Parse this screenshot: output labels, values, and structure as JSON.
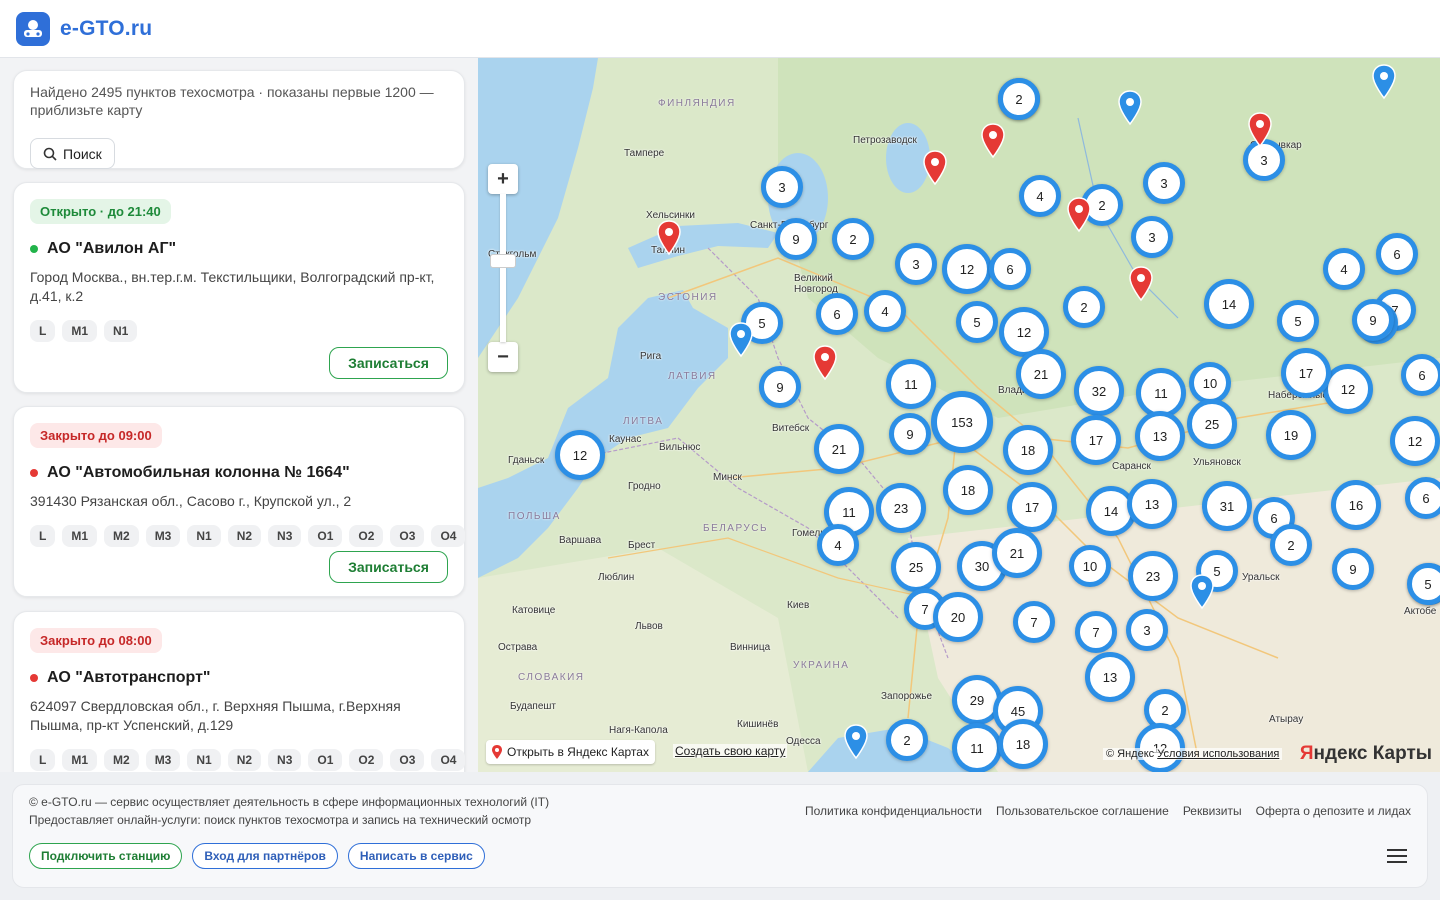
{
  "header": {
    "logo_text": "e-GTO.ru"
  },
  "search": {
    "found_text": "Найдено 2495 пунктов техосмотра · показаны первые 1200 — приблизьте карту",
    "button_label": "Поиск"
  },
  "stations": [
    {
      "status": "Открыто · до 21:40",
      "status_type": "open",
      "name": "АО \"Авилон АГ\"",
      "address": "Город Москва., вн.тер.г.м. Текстильщики, Волгоградский пр-кт, д.41, к.2",
      "tags": [
        "L",
        "M1",
        "N1"
      ],
      "book_label": "Записаться"
    },
    {
      "status": "Закрыто до 09:00",
      "status_type": "closed",
      "name": "АО \"Автомобильная колонна № 1664\"",
      "address": "391430 Рязанская обл., Сасово г., Крупской ул., 2",
      "tags": [
        "L",
        "M1",
        "M2",
        "M3",
        "N1",
        "N2",
        "N3",
        "O1",
        "O2",
        "O3",
        "O4"
      ],
      "book_label": "Записаться"
    },
    {
      "status": "Закрыто до 08:00",
      "status_type": "closed",
      "name": "АО \"Автотранспорт\"",
      "address": "624097 Свердловская обл., г. Верхняя Пышма, г.Верхняя Пышма, пр-кт Успенский, д.129",
      "tags": [
        "L",
        "M1",
        "M2",
        "M3",
        "N1",
        "N2",
        "N3",
        "O1",
        "O2",
        "O3",
        "O4"
      ]
    }
  ],
  "map": {
    "open_in_yandex": "Открыть в Яндекс Картах",
    "create_map": "Создать свою карту",
    "copyright": "© Яндекс",
    "terms": "Условия использования",
    "brand_prefix": "Я",
    "brand_rest": "ндекс Карты",
    "cities": [
      "Петрозаводск",
      "Тампере",
      "Хельсинки",
      "Таллин",
      "Санкт-Петербург",
      "Стокгольм",
      "Великий Новгород",
      "Рига",
      "Витебск",
      "Каунас",
      "Вильнюс",
      "Гданьск",
      "Гродно",
      "Минск",
      "Варшава",
      "Брест",
      "Гомель",
      "Люблин",
      "Катовице",
      "Львов",
      "Киев",
      "Винница",
      "Острава",
      "Будапешт",
      "Запорожье",
      "Кишинёв",
      "Нагя-Кaпoлa",
      "Одесса",
      "Саранск",
      "Ульяновск",
      "Уральск",
      "Актобе",
      "Атырау",
      "Набережные Челны",
      "Сыктывкар",
      "Владимир"
    ],
    "countries": [
      "ФИНЛЯНДИЯ",
      "ЭСТОНИЯ",
      "ЛАТВИЯ",
      "ЛИТВА",
      "ПОЛЬША",
      "БЕЛАРУСЬ",
      "УКРАИНА",
      "СЛОВАКИЯ"
    ],
    "clusters": [
      "2",
      "3",
      "4",
      "2",
      "3",
      "3",
      "12",
      "6",
      "5",
      "2",
      "14",
      "12",
      "21",
      "32",
      "11",
      "10",
      "153",
      "9",
      "11",
      "18",
      "17",
      "13",
      "25",
      "19",
      "21",
      "12",
      "18",
      "17",
      "14",
      "13",
      "31",
      "6",
      "2",
      "16",
      "11",
      "23",
      "4",
      "25",
      "30",
      "21",
      "10",
      "23",
      "5",
      "7",
      "20",
      "7",
      "7",
      "3",
      "13",
      "2",
      "29",
      "45",
      "11",
      "18",
      "2",
      "9",
      "3",
      "9",
      "2",
      "6",
      "4",
      "5",
      "6",
      "4",
      "9",
      "12",
      "3",
      "17",
      "12",
      "6",
      "7",
      "12",
      "5",
      "6",
      "4",
      "7",
      "9",
      "5",
      "2"
    ]
  },
  "footer": {
    "line1": "© e-GTO.ru — сервис осуществляет деятельность в сфере информационных технологий (IT)",
    "line2": "Предоставляет онлайн-услуги: поиск пунктов техосмотра и запись на технический осмотр",
    "links": [
      "Политика конфиденциальности",
      "Пользовательское соглашение",
      "Реквизиты",
      "Оферта о депозите и лидах"
    ],
    "buttons": [
      "Подключить станцию",
      "Вход для партнёров",
      "Написать в сервис"
    ]
  },
  "colors": {
    "accent": "#2f6fd8",
    "cluster_border": "#2c8fe6",
    "open": "#1e8a3a",
    "closed": "#c62828",
    "pin_red": "#e53935"
  }
}
